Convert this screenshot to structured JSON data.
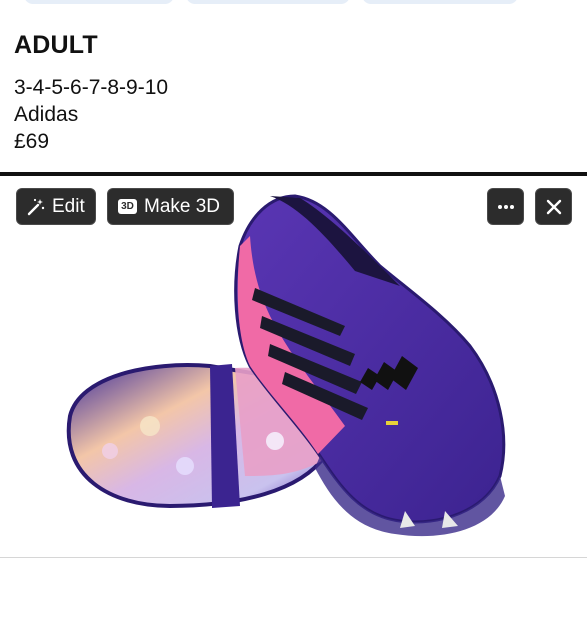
{
  "post": {
    "heading": "ADULT",
    "sizes": "3-4-5-6-7-8-9-10",
    "brand": "Adidas",
    "price": "£69"
  },
  "image_toolbar": {
    "edit_label": "Edit",
    "make3d_label": "Make 3D",
    "make3d_badge": "3D"
  },
  "icons": {
    "edit": "magic-wand-icon",
    "make3d": "3d-badge-icon",
    "more": "ellipsis-icon",
    "close": "close-icon"
  },
  "colors": {
    "boot_purple": "#4a2a9a",
    "boot_pink": "#f06aa6",
    "stripe_black": "#1a1a2a",
    "button_bg": "#2c2c2c"
  }
}
